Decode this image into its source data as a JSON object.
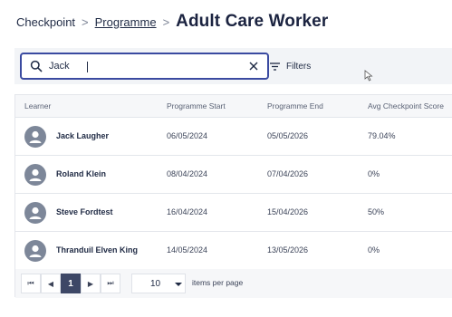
{
  "breadcrumb": {
    "root": "Checkpoint",
    "separator": ">",
    "link": "Programme",
    "title": "Adult Care Worker"
  },
  "search": {
    "value": "Jack",
    "icon": "search-icon",
    "clear_icon": "close-icon"
  },
  "filters": {
    "label": "Filters",
    "icon": "filter-icon"
  },
  "table": {
    "columns": [
      "Learner",
      "Programme Start",
      "Programme End",
      "Avg Checkpoint Score"
    ],
    "rows": [
      {
        "name": "Jack Laugher",
        "start": "06/05/2024",
        "end": "05/05/2026",
        "score": "79.04%"
      },
      {
        "name": "Roland Klein",
        "start": "08/04/2024",
        "end": "07/04/2026",
        "score": "0%"
      },
      {
        "name": "Steve Fordtest",
        "start": "16/04/2024",
        "end": "15/04/2026",
        "score": "50%"
      },
      {
        "name": "Thranduil Elven King",
        "start": "14/05/2024",
        "end": "13/05/2026",
        "score": "0%"
      }
    ]
  },
  "pagination": {
    "first": "⏮",
    "prev": "◀",
    "current": "1",
    "next": "▶",
    "last": "⏭",
    "page_size": "10",
    "page_size_label": "items per page"
  },
  "colors": {
    "accent": "#3a4aa0",
    "active_page": "#3d4766",
    "avatar": "#7d8799"
  }
}
